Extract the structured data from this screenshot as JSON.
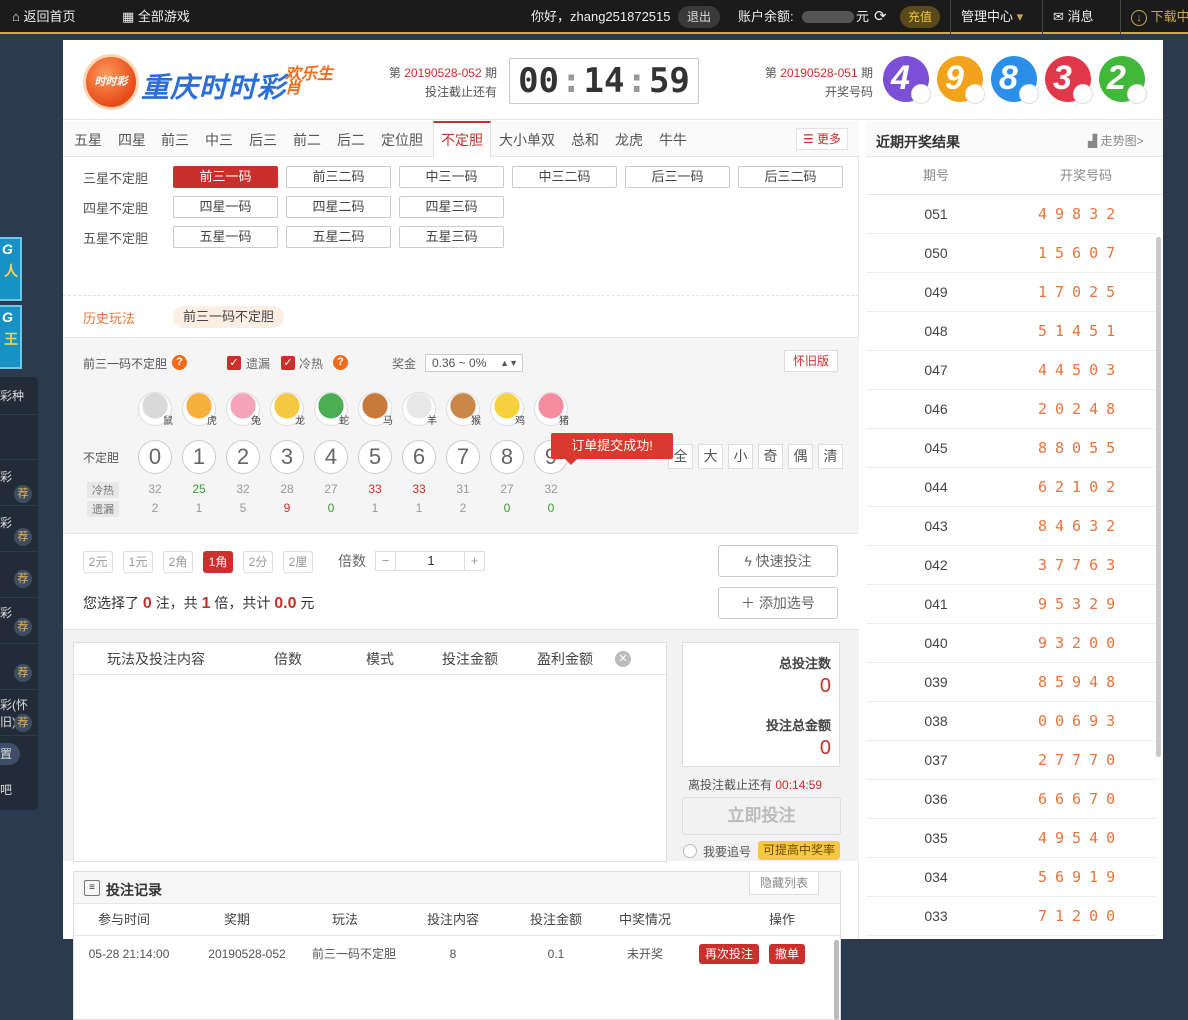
{
  "topbar": {
    "home": "返回首页",
    "all_games": "全部游戏",
    "greeting": "你好，zhang251872515",
    "logout": "退出",
    "balance_label": "账户余额:",
    "balance_unit": "元",
    "recharge": "充值",
    "manage": "管理中心",
    "messages": "消息",
    "download": "下载中"
  },
  "sidebar": {
    "ads": [
      {
        "line1": "G",
        "line2": "人"
      },
      {
        "line1": "G",
        "line2": "王"
      }
    ],
    "items": [
      "彩种",
      "",
      "彩",
      "彩",
      "",
      "彩",
      "",
      "彩(怀旧)",
      "置",
      "吧"
    ],
    "tag": "荐"
  },
  "header": {
    "logo_badge": "时时彩",
    "title": "重庆时时彩",
    "slogan": "欢乐生肖",
    "current_prefix": "第",
    "current_issue": "20190528-052",
    "current_suffix": "期",
    "deadline_label": "投注截止还有",
    "timer": {
      "h": "00",
      "m": "14",
      "s": "59"
    },
    "last_prefix": "第",
    "last_issue": "20190528-051",
    "last_suffix": "期",
    "last_label": "开奖号码",
    "last_balls": [
      {
        "n": "4",
        "color": "#7b4fd6"
      },
      {
        "n": "9",
        "color": "#f2a31b"
      },
      {
        "n": "8",
        "color": "#2b8ee8"
      },
      {
        "n": "3",
        "color": "#e0384a"
      },
      {
        "n": "2",
        "color": "#42b83a"
      }
    ]
  },
  "tabs": [
    "五星",
    "四星",
    "前三",
    "中三",
    "后三",
    "前二",
    "后二",
    "定位胆",
    "不定胆",
    "大小单双",
    "总和",
    "龙虎",
    "牛牛"
  ],
  "more": "更多",
  "subplays": {
    "rows": [
      {
        "label": "三星不定胆",
        "items": [
          "前三一码",
          "前三二码",
          "中三一码",
          "中三二码",
          "后三一码",
          "后三二码"
        ]
      },
      {
        "label": "四星不定胆",
        "items": [
          "四星一码",
          "四星二码",
          "四星三码"
        ]
      },
      {
        "label": "五星不定胆",
        "items": [
          "五星一码",
          "五星二码",
          "五星三码"
        ]
      }
    ]
  },
  "history": {
    "label": "历史玩法",
    "badge": "前三一码不定胆"
  },
  "play": {
    "name": "前三一码不定胆",
    "missing": "遗漏",
    "hotcold": "冷热",
    "prize_label": "奖金",
    "prize_value": "0.36 ~ 0%",
    "old_version": "怀旧版",
    "zodiacs": [
      "鼠",
      "虎",
      "兔",
      "龙",
      "蛇",
      "马",
      "羊",
      "猴",
      "鸡",
      "猪"
    ],
    "row_label": "不定胆",
    "numbers": [
      "0",
      "1",
      "2",
      "3",
      "4",
      "5",
      "6",
      "7",
      "8",
      "9"
    ],
    "picks": [
      "全",
      "大",
      "小",
      "奇",
      "偶",
      "清"
    ],
    "hot_label": "冷热",
    "miss_label": "遗漏",
    "hot": [
      {
        "v": "32",
        "c": "#999"
      },
      {
        "v": "25",
        "c": "#3aa335"
      },
      {
        "v": "32",
        "c": "#999"
      },
      {
        "v": "28",
        "c": "#999"
      },
      {
        "v": "27",
        "c": "#999"
      },
      {
        "v": "33",
        "c": "#c9302c"
      },
      {
        "v": "33",
        "c": "#c9302c"
      },
      {
        "v": "31",
        "c": "#999"
      },
      {
        "v": "27",
        "c": "#999"
      },
      {
        "v": "32",
        "c": "#999"
      }
    ],
    "miss": [
      {
        "v": "2",
        "c": "#999"
      },
      {
        "v": "1",
        "c": "#999"
      },
      {
        "v": "5",
        "c": "#999"
      },
      {
        "v": "9",
        "c": "#c9302c"
      },
      {
        "v": "0",
        "c": "#3aa335"
      },
      {
        "v": "1",
        "c": "#999"
      },
      {
        "v": "1",
        "c": "#999"
      },
      {
        "v": "2",
        "c": "#999"
      },
      {
        "v": "0",
        "c": "#3aa335"
      },
      {
        "v": "0",
        "c": "#3aa335"
      }
    ]
  },
  "toast": "订单提交成功!",
  "money": {
    "modes": [
      "2元",
      "1元",
      "2角",
      "1角",
      "2分",
      "2厘"
    ],
    "active": "1角",
    "mult_label": "倍数",
    "minus": "−",
    "plus": "+",
    "mult_value": "1",
    "summary_a": "您选择了",
    "count": "0",
    "summary_b": "注，共",
    "times": "1",
    "summary_c": "倍，共计",
    "amount": "0.0",
    "summary_d": "元",
    "quick_bet": "快速投注",
    "add_pick": "添加选号"
  },
  "cart": {
    "headers": [
      "玩法及投注内容",
      "倍数",
      "模式",
      "投注金额",
      "盈利金额"
    ]
  },
  "totals": {
    "bets_label": "总投注数",
    "bets": "0",
    "amount_label": "投注总金额",
    "amount": "0",
    "deadline_label": "离投注截止还有",
    "deadline": "00:14:59",
    "bet_now": "立即投注",
    "chase": "我要追号",
    "chase_tip": "可提高中奖率"
  },
  "records": {
    "title": "投注记录",
    "hide": "隐藏列表",
    "headers": [
      "参与时间",
      "奖期",
      "玩法",
      "投注内容",
      "投注金额",
      "中奖情况",
      "操作"
    ],
    "row": {
      "time": "05-28 21:14:00",
      "issue": "20190528-052",
      "play": "前三一码不定胆",
      "content": "8",
      "amount": "0.1",
      "status": "未开奖",
      "rebet": "再次投注",
      "cancel": "撤单"
    }
  },
  "results": {
    "title": "近期开奖结果",
    "trend": "走势图>",
    "col_issue": "期号",
    "col_nums": "开奖号码",
    "rows": [
      {
        "i": "051",
        "n": "49832"
      },
      {
        "i": "050",
        "n": "15607"
      },
      {
        "i": "049",
        "n": "17025"
      },
      {
        "i": "048",
        "n": "51451"
      },
      {
        "i": "047",
        "n": "44503"
      },
      {
        "i": "046",
        "n": "20248"
      },
      {
        "i": "045",
        "n": "88055"
      },
      {
        "i": "044",
        "n": "62102"
      },
      {
        "i": "043",
        "n": "84632"
      },
      {
        "i": "042",
        "n": "37763"
      },
      {
        "i": "041",
        "n": "95329"
      },
      {
        "i": "040",
        "n": "93200"
      },
      {
        "i": "039",
        "n": "85948"
      },
      {
        "i": "038",
        "n": "00693"
      },
      {
        "i": "037",
        "n": "27770"
      },
      {
        "i": "036",
        "n": "66670"
      },
      {
        "i": "035",
        "n": "49540"
      },
      {
        "i": "034",
        "n": "56919"
      },
      {
        "i": "033",
        "n": "71200"
      }
    ]
  }
}
